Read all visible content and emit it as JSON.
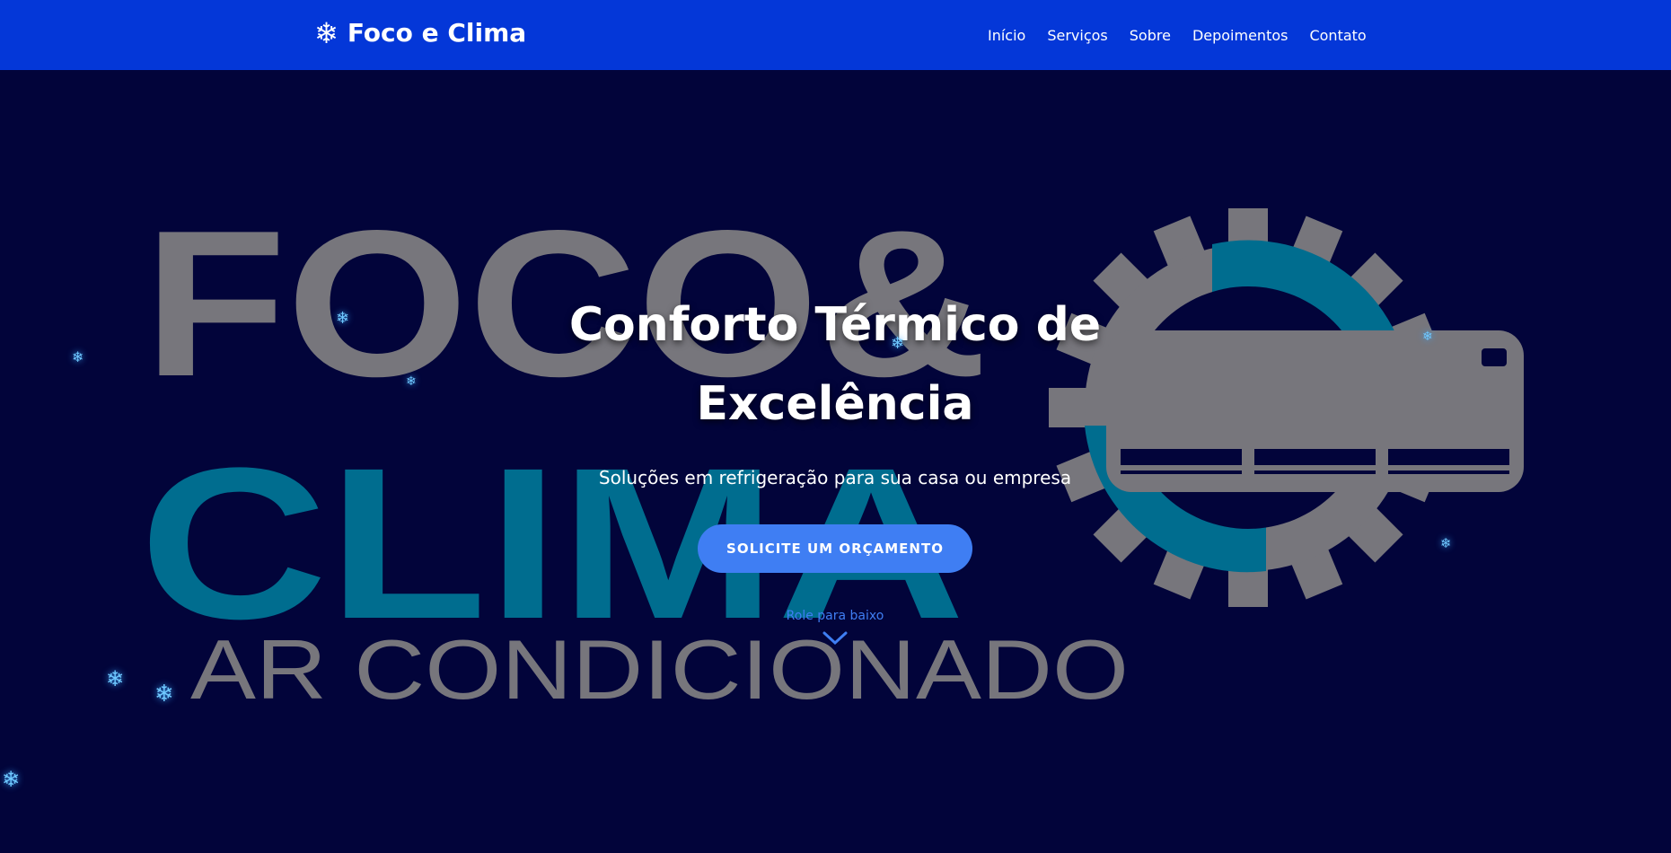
{
  "header": {
    "brand": {
      "icon": "snowflake-icon",
      "glyph": "❄",
      "name": "Foco e Clima"
    },
    "nav": [
      {
        "label": "Início"
      },
      {
        "label": "Serviços"
      },
      {
        "label": "Sobre"
      },
      {
        "label": "Depoimentos"
      },
      {
        "label": "Contato"
      }
    ]
  },
  "hero": {
    "background_logo": {
      "line1": "FOCO&",
      "line2": "CLIMA",
      "line3": "AR CONDICIONADO"
    },
    "title_line1": "Conforto Térmico de",
    "title_line2": "Excelência",
    "subtitle": "Soluções em refrigeração para sua casa ou empresa",
    "cta_label": "SOLICITE UM ORÇAMENTO",
    "scroll_hint": "Role para baixo",
    "snowflake_glyph": "❄"
  },
  "colors": {
    "navbar": "#0437d8",
    "background": "#02043a",
    "accent": "#3f7ef3",
    "logo_gray": "#77767c",
    "logo_teal": "#006d8f"
  }
}
